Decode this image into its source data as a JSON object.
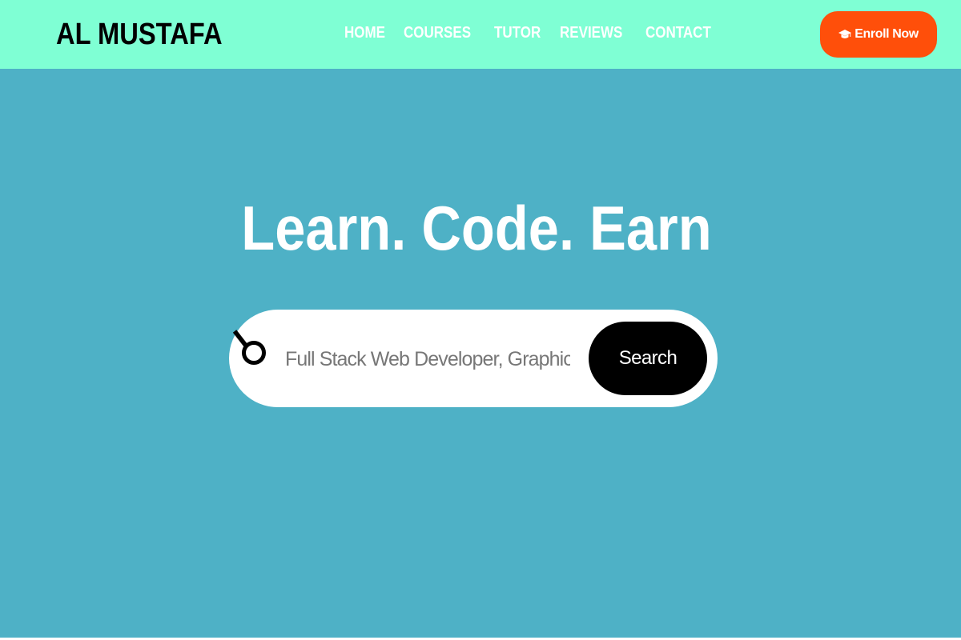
{
  "header": {
    "logo": "AL MUSTAFA",
    "nav": [
      {
        "label": "HOME"
      },
      {
        "label": "COURSES"
      },
      {
        "label": "TUTOR"
      },
      {
        "label": "REVIEWS"
      },
      {
        "label": "CONTACT"
      }
    ],
    "enroll": {
      "label": "Enroll Now",
      "icon": "graduation-cap-icon"
    }
  },
  "hero": {
    "title": "Learn. Code. Earn",
    "search": {
      "icon": "search-icon",
      "placeholder": "Full Stack Web Developer, Graphic Design",
      "button_label": "Search"
    }
  },
  "colors": {
    "nav_bg": "#7fffd4",
    "page_bg": "#4eb1c6",
    "accent": "#ff4f0a",
    "search_button": "#000000"
  }
}
